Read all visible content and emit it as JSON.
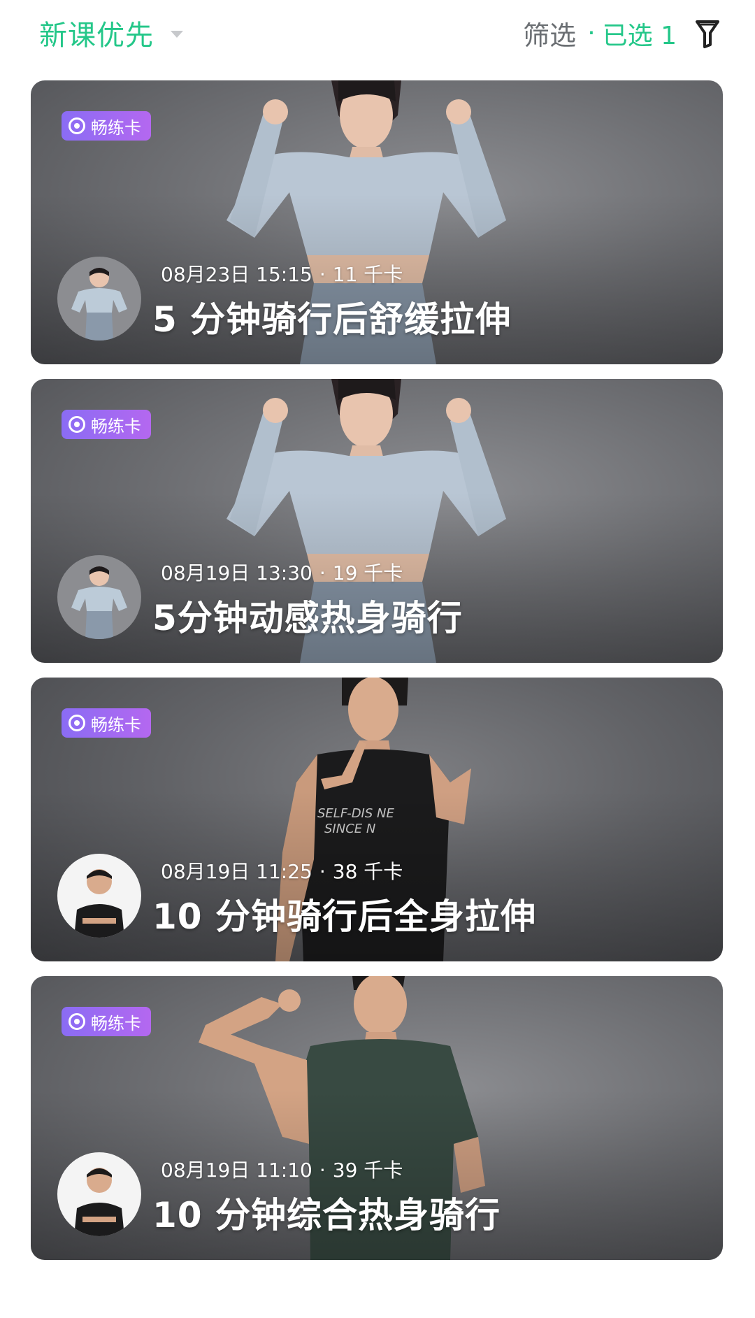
{
  "header": {
    "sort_label": "新课优先",
    "filter_label": "筛选",
    "filter_dot": "·",
    "filter_selected": "已选 1"
  },
  "colors": {
    "accent": "#24c789",
    "badge_start": "#8a6cf4",
    "badge_end": "#b468f0"
  },
  "courses": [
    {
      "badge": "畅练卡",
      "date": "08月23日 15:15",
      "sep": "·",
      "calories": "11 千卡",
      "title": "5 分钟骑行后舒缓拉伸"
    },
    {
      "badge": "畅练卡",
      "date": "08月19日 13:30",
      "sep": "·",
      "calories": "19 千卡",
      "title": "5分钟动感热身骑行"
    },
    {
      "badge": "畅练卡",
      "date": "08月19日 11:25",
      "sep": "·",
      "calories": "38 千卡",
      "title": "10 分钟骑行后全身拉伸"
    },
    {
      "badge": "畅练卡",
      "date": "08月19日 11:10",
      "sep": "·",
      "calories": "39 千卡",
      "title": "10 分钟综合热身骑行"
    }
  ]
}
